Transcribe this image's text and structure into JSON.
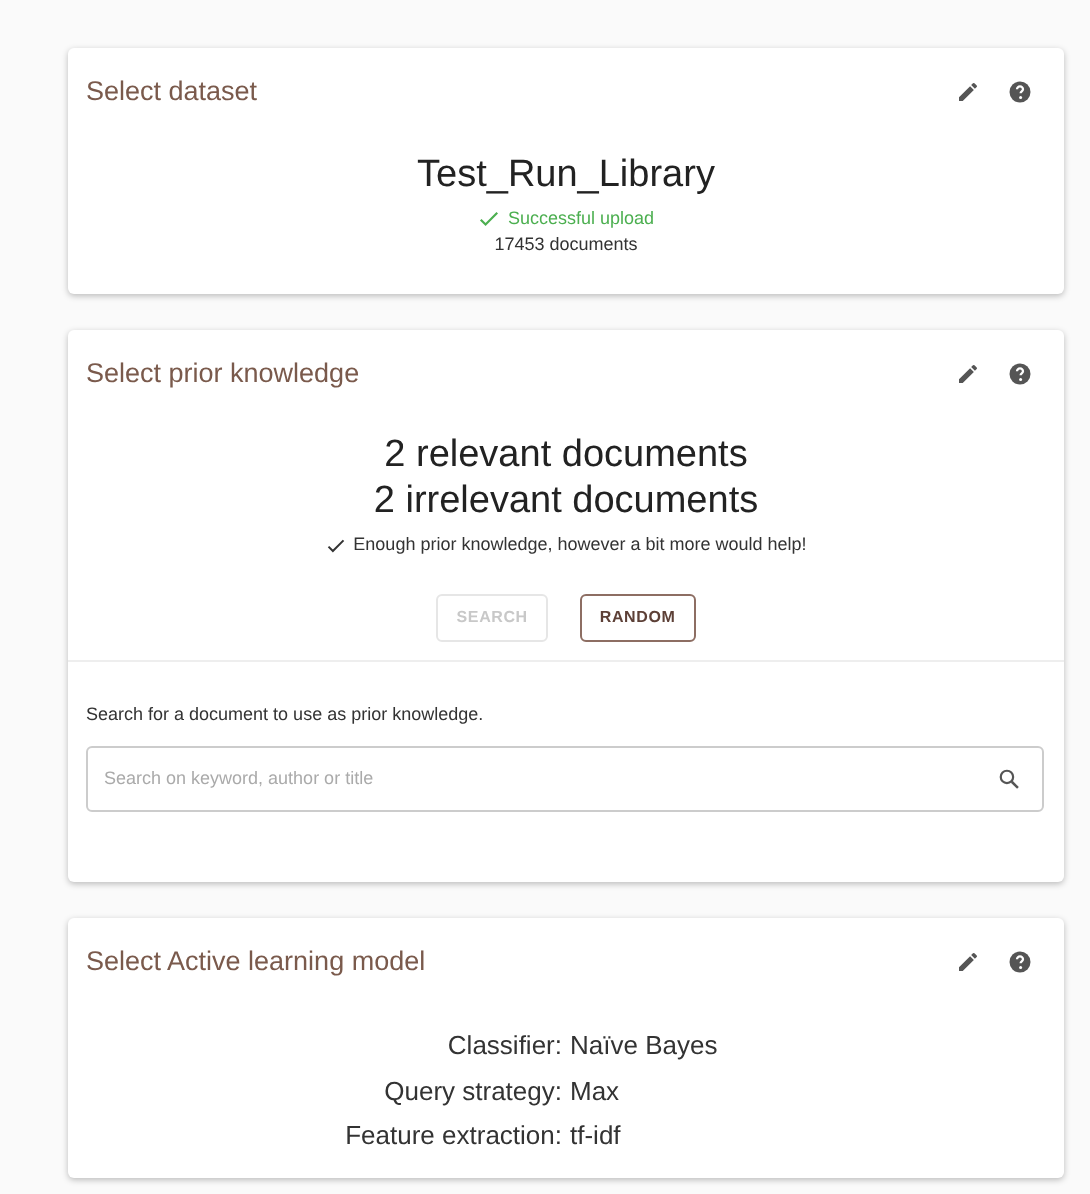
{
  "dataset_card": {
    "title": "Select dataset",
    "name": "Test_Run_Library",
    "status": "Successful upload",
    "count": "17453 documents"
  },
  "prior_card": {
    "title": "Select prior knowledge",
    "lines": [
      "2 relevant documents",
      "2 irrelevant documents"
    ],
    "note": "Enough prior knowledge, however a bit more would help!",
    "buttons": [
      {
        "label": "SEARCH",
        "disabled": true
      },
      {
        "label": "RANDOM",
        "disabled": false
      }
    ],
    "search_hint": "Search for a document to use as prior knowledge.",
    "search": {
      "placeholder": "Search on keyword, author or title"
    }
  },
  "model_card": {
    "title": "Select Active learning model",
    "settings": [
      {
        "label": "Classifier:",
        "value": "Naïve Bayes"
      },
      {
        "label": "Query strategy:",
        "value": "Max"
      },
      {
        "label": "Feature extraction:",
        "value": "tf-idf"
      }
    ]
  }
}
